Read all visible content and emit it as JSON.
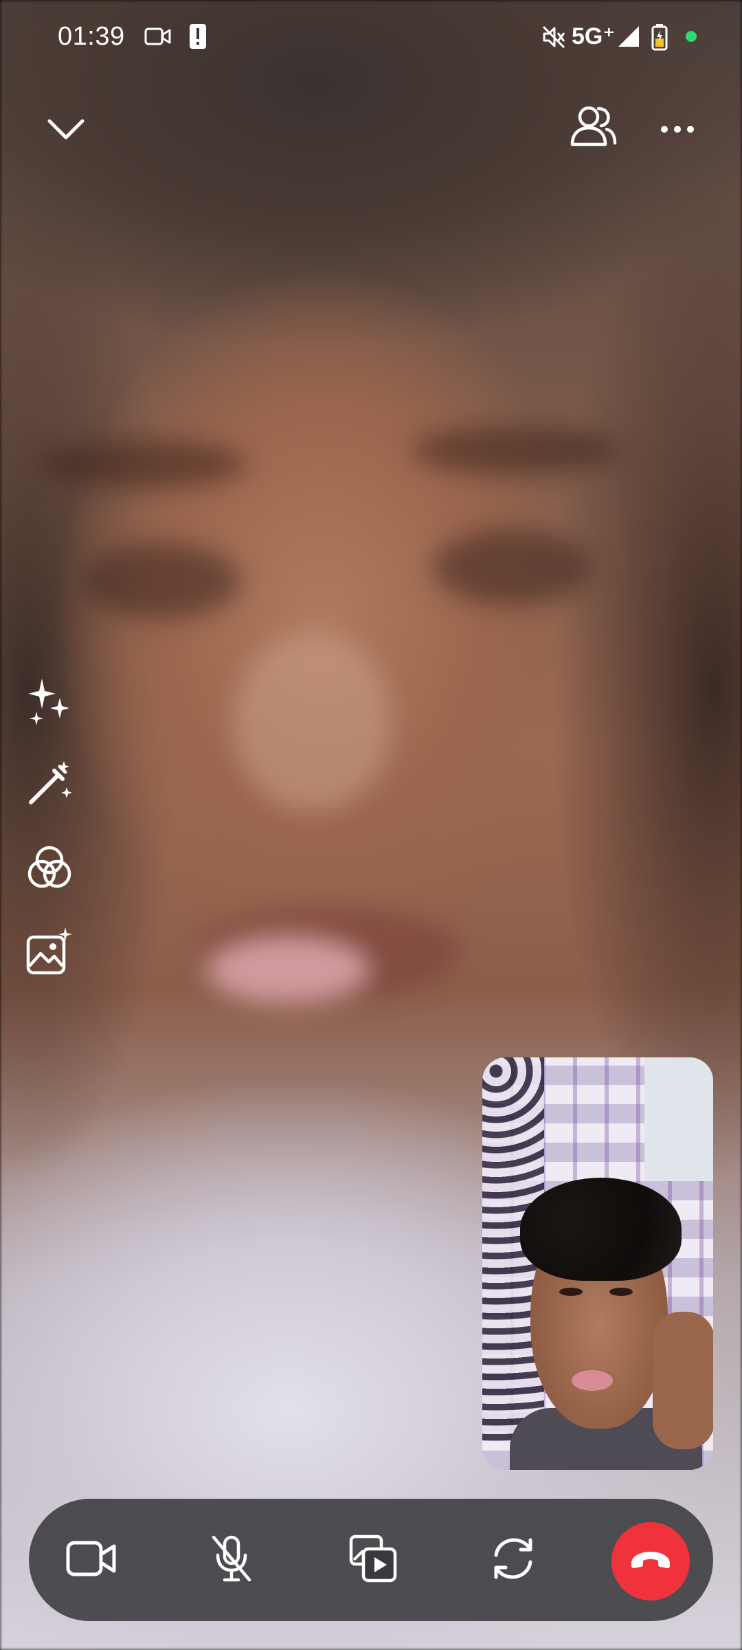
{
  "status_bar": {
    "time": "01:39",
    "network": "5G⁺",
    "icons": [
      "video-camera-icon",
      "alert-icon",
      "mute-icon",
      "signal-icon",
      "battery-icon",
      "privacy-dot"
    ]
  },
  "top_controls": {
    "minimize_icon": "chevron-down-icon",
    "participants_icon": "people-icon",
    "more_icon": "more-horizontal-icon"
  },
  "effects_toolbar": [
    "sparkles-icon",
    "magic-wand-icon",
    "filters-icon",
    "background-icon"
  ],
  "call_controls": [
    "video-camera-icon",
    "mic-off-icon",
    "screen-share-icon",
    "flip-camera-icon",
    "end-call-icon"
  ],
  "colors": {
    "end_call": "#f0323c",
    "controls_bar": "#3a3a3e",
    "privacy_dot": "#2fd86a"
  }
}
